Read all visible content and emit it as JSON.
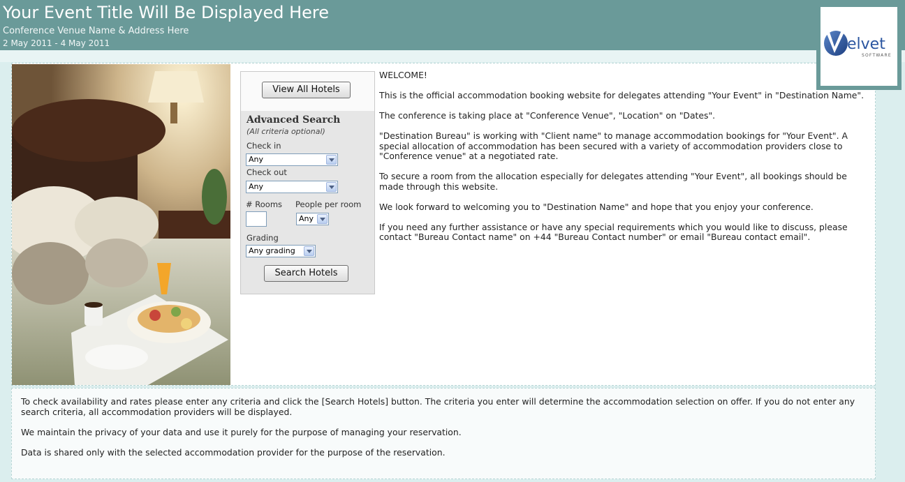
{
  "header": {
    "event_title": "Your Event Title Will Be Displayed Here",
    "venue": "Conference Venue Name & Address Here",
    "dates": "2 May 2011 - 4 May 2011",
    "logo_text": "elvet",
    "logo_subtext": "SOFTWARE",
    "colors": {
      "header_bg": "#6a9a99",
      "band_bg": "#dbeeee"
    }
  },
  "search": {
    "view_all_label": "View All Hotels",
    "title": "Advanced Search",
    "subtitle": "(All criteria optional)",
    "checkin_label": "Check in",
    "checkin_value": "Any",
    "checkout_label": "Check out",
    "checkout_value": "Any",
    "rooms_label": "# Rooms",
    "rooms_value": "",
    "people_label": "People per room",
    "people_value": "Any",
    "grading_label": "Grading",
    "grading_value": "Any grading",
    "search_label": "Search Hotels"
  },
  "welcome": {
    "heading": "WELCOME!",
    "paragraphs": [
      "This is the official accommodation booking website for delegates attending \"Your Event\" in \"Destination Name\".",
      "The conference is taking place at \"Conference Venue\", \"Location\" on \"Dates\".",
      "\"Destination Bureau\" is working with \"Client name\" to manage accommodation bookings for \"Your Event\". A special allocation of accommodation has been secured with a variety of accommodation providers close to \"Conference venue\" at a negotiated rate.",
      "To secure a room from the allocation especially for delegates attending \"Your Event\", all bookings should be made through this website.",
      "We look forward to welcoming you to \"Destination Name\" and hope that you enjoy your conference.",
      "If you need any further assistance or have any special requirements which you would like to discuss, please contact \"Bureau Contact name\" on +44 \"Bureau Contact number\" or email \"Bureau contact email\"."
    ]
  },
  "footer": {
    "paragraphs": [
      "To check availability and rates please enter any criteria and click the [Search Hotels] button. The criteria you enter will determine the accommodation selection on offer. If you do not enter any search criteria, all accommodation providers will be displayed.",
      "We maintain the privacy of your data and use it purely for the purpose of managing your reservation.",
      "Data is shared only with the selected accommodation provider for the purpose of the reservation."
    ]
  }
}
